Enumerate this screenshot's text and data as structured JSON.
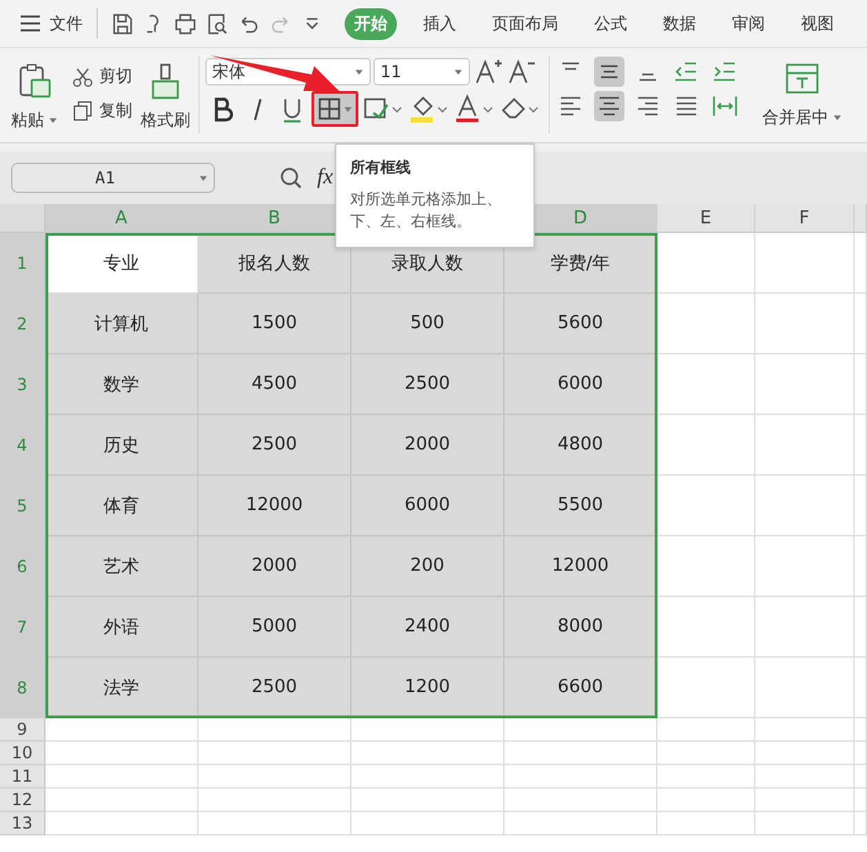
{
  "menu": {
    "file": "文件",
    "tabs": [
      {
        "label": "开始",
        "selected": true
      },
      {
        "label": "插入",
        "selected": false
      },
      {
        "label": "页面布局",
        "selected": false
      },
      {
        "label": "公式",
        "selected": false
      },
      {
        "label": "数据",
        "selected": false
      },
      {
        "label": "审阅",
        "selected": false
      },
      {
        "label": "视图",
        "selected": false
      }
    ]
  },
  "ribbon": {
    "paste": "粘贴",
    "cut": "剪切",
    "copy": "复制",
    "format_painter": "格式刷",
    "font": "宋体",
    "font_size": "11",
    "merge": "合并居中"
  },
  "name_box": "A1",
  "formula_label": "fx",
  "tooltip": {
    "title": "所有框线",
    "body": "对所选单元格添加上、下、左、右框线。"
  },
  "columns": [
    {
      "label": "A",
      "selected": true
    },
    {
      "label": "B",
      "selected": true
    },
    {},
    {
      "label": "D",
      "selected": true
    },
    {
      "label": "E",
      "selected": false
    },
    {
      "label": "F",
      "selected": false
    }
  ],
  "rows": [
    {
      "label": "1",
      "selected": true,
      "cells": [
        {
          "text": "专业",
          "selected": true,
          "active": true
        },
        {
          "text": "报名人数",
          "selected": true,
          "active": false
        },
        {
          "text": "录取人数",
          "selected": true,
          "active": false
        },
        {
          "text": "学费/年",
          "selected": true,
          "active": false
        }
      ]
    },
    {
      "label": "2",
      "selected": true,
      "cells": [
        {
          "text": "计算机",
          "selected": true,
          "active": false
        },
        {
          "text": "1500",
          "selected": true,
          "active": false
        },
        {
          "text": "500",
          "selected": true,
          "active": false
        },
        {
          "text": "5600",
          "selected": true,
          "active": false
        }
      ]
    },
    {
      "label": "3",
      "selected": true,
      "cells": [
        {
          "text": "数学",
          "selected": true,
          "active": false
        },
        {
          "text": "4500",
          "selected": true,
          "active": false
        },
        {
          "text": "2500",
          "selected": true,
          "active": false
        },
        {
          "text": "6000",
          "selected": true,
          "active": false
        }
      ]
    },
    {
      "label": "4",
      "selected": true,
      "cells": [
        {
          "text": "历史",
          "selected": true,
          "active": false
        },
        {
          "text": "2500",
          "selected": true,
          "active": false
        },
        {
          "text": "2000",
          "selected": true,
          "active": false
        },
        {
          "text": "4800",
          "selected": true,
          "active": false
        }
      ]
    },
    {
      "label": "5",
      "selected": true,
      "cells": [
        {
          "text": "体育",
          "selected": true,
          "active": false
        },
        {
          "text": "12000",
          "selected": true,
          "active": false
        },
        {
          "text": "6000",
          "selected": true,
          "active": false
        },
        {
          "text": "5500",
          "selected": true,
          "active": false
        }
      ]
    },
    {
      "label": "6",
      "selected": true,
      "cells": [
        {
          "text": "艺术",
          "selected": true,
          "active": false
        },
        {
          "text": "2000",
          "selected": true,
          "active": false
        },
        {
          "text": "200",
          "selected": true,
          "active": false
        },
        {
          "text": "12000",
          "selected": true,
          "active": false
        }
      ]
    },
    {
      "label": "7",
      "selected": true,
      "cells": [
        {
          "text": "外语",
          "selected": true,
          "active": false
        },
        {
          "text": "5000",
          "selected": true,
          "active": false
        },
        {
          "text": "2400",
          "selected": true,
          "active": false
        },
        {
          "text": "8000",
          "selected": true,
          "active": false
        }
      ]
    },
    {
      "label": "8",
      "selected": true,
      "cells": [
        {
          "text": "法学",
          "selected": true,
          "active": false
        },
        {
          "text": "2500",
          "selected": true,
          "active": false
        },
        {
          "text": "1200",
          "selected": true,
          "active": false
        },
        {
          "text": "6600",
          "selected": true,
          "active": false
        }
      ]
    },
    {
      "label": "9",
      "selected": false,
      "cells": []
    },
    {
      "label": "10",
      "selected": false,
      "cells": []
    },
    {
      "label": "11",
      "selected": false,
      "cells": []
    },
    {
      "label": "12",
      "selected": false,
      "cells": []
    },
    {
      "label": "13",
      "selected": false,
      "cells": []
    }
  ]
}
